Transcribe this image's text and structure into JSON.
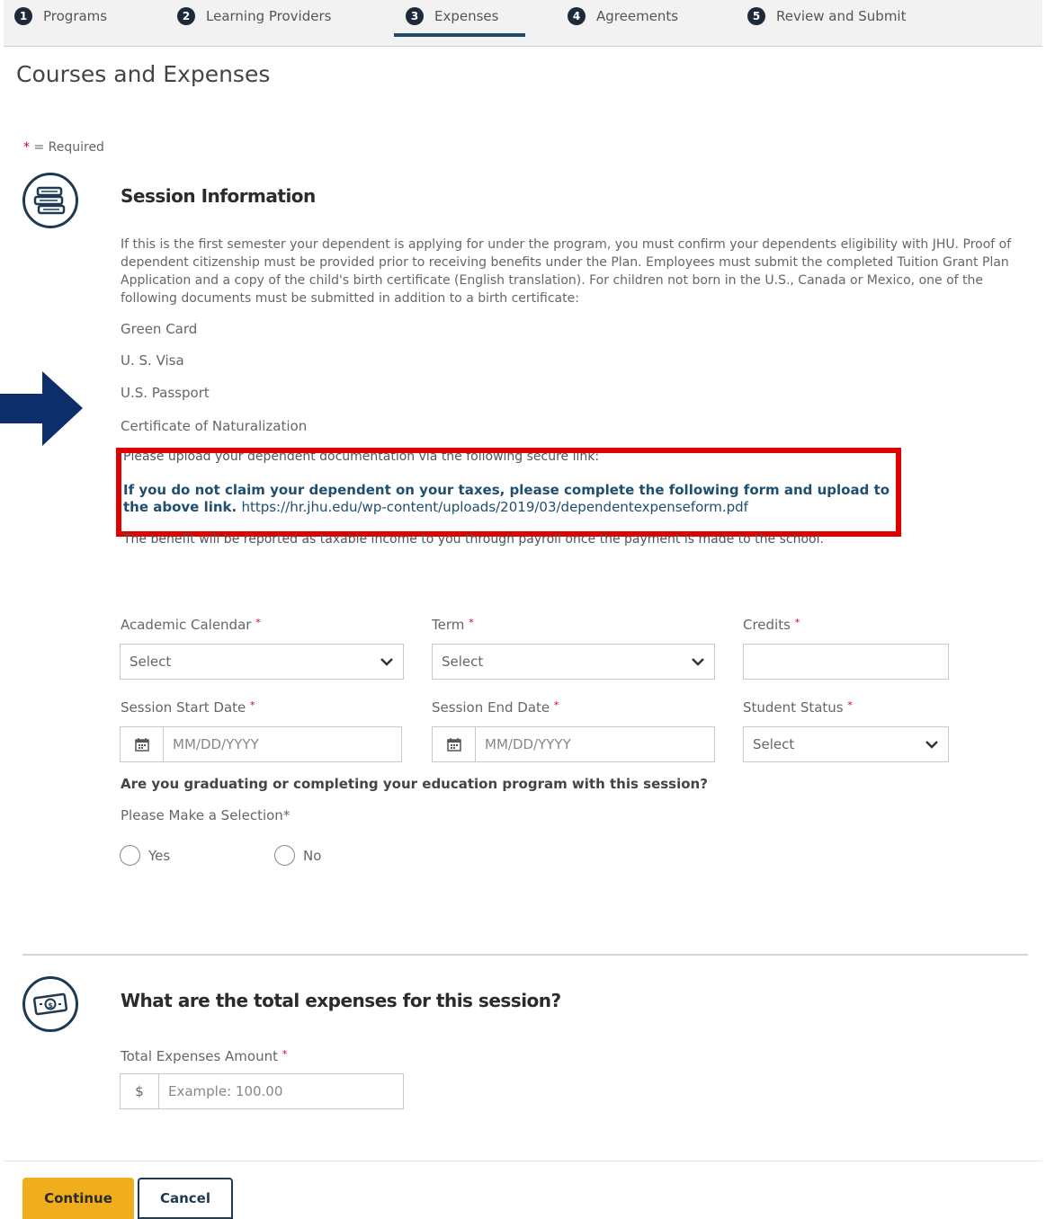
{
  "stepper": {
    "steps": [
      {
        "num": "1",
        "label": "Programs"
      },
      {
        "num": "2",
        "label": "Learning Providers"
      },
      {
        "num": "3",
        "label": "Expenses"
      },
      {
        "num": "4",
        "label": "Agreements"
      },
      {
        "num": "5",
        "label": "Review and Submit"
      }
    ],
    "active_step": "Expenses"
  },
  "page_title": "Courses and Expenses",
  "required_note": {
    "star": "*",
    "text": " = Required"
  },
  "session": {
    "title": "Session Information",
    "icon": "books-icon",
    "intro": "If this is the first semester your dependent is applying for under the program, you must confirm your dependents eligibility with JHU. Proof of dependent citizenship must be provided prior to receiving benefits under the Plan. Employees must submit the completed Tuition Grant Plan Application and a copy of the child's birth certificate (English translation). For children not born in the U.S., Canada or Mexico, one of the following documents must be submitted in addition to a birth certificate:",
    "documents": [
      "Green Card",
      "U. S. Visa",
      "U.S. Passport",
      "Certificate of Naturalization"
    ],
    "upload_line": "Please upload your dependent documentation via the following secure link:",
    "taxes_text": "If you do not claim your dependent on your taxes, please complete the following form and upload to the above link.",
    "taxes_link": "https://hr.jhu.edu/wp-content/uploads/2019/03/dependentexpenseform.pdf",
    "benefit_line": "The benefit will be reported as taxable income to you through payroll once the payment is made to the school."
  },
  "form": {
    "academic_calendar": {
      "label": "Academic Calendar",
      "value": "Select"
    },
    "term": {
      "label": "Term",
      "value": "Select"
    },
    "credits": {
      "label": "Credits",
      "value": ""
    },
    "session_start": {
      "label": "Session Start Date",
      "placeholder": "MM/DD/YYYY"
    },
    "session_end": {
      "label": "Session End Date",
      "placeholder": "MM/DD/YYYY"
    },
    "student_status": {
      "label": "Student Status",
      "value": "Select"
    },
    "required_star": "*",
    "question": "Are you graduating or completing your education program with this session?",
    "selection_label": "Please Make a Selection*",
    "options": [
      "Yes",
      "No"
    ]
  },
  "expenses": {
    "title": "What are the total expenses for this session?",
    "icon": "money-icon",
    "amount_label": "Total Expenses Amount",
    "currency": "$",
    "placeholder": "Example: 100.00"
  },
  "actions": {
    "continue": "Continue",
    "cancel": "Cancel"
  },
  "colors": {
    "accent": "#1f4a6e",
    "highlight_box": "#e00000",
    "primary_button": "#f0ae1c",
    "arrow": "#0d2d6b"
  }
}
